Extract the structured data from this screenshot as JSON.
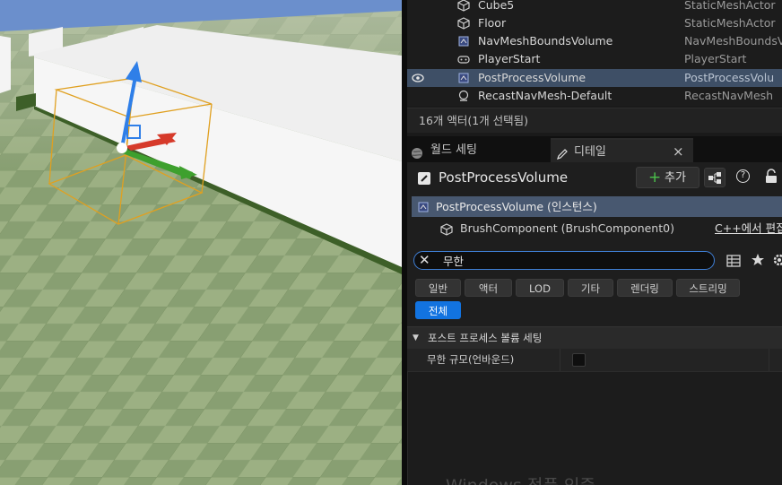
{
  "outliner": {
    "rows": [
      {
        "name": "Cube5",
        "type": "StaticMeshActor",
        "icon": "static-mesh-icon"
      },
      {
        "name": "Floor",
        "type": "StaticMeshActor",
        "icon": "static-mesh-icon"
      },
      {
        "name": "NavMeshBoundsVolume",
        "type": "NavMeshBoundsV",
        "icon": "volume-icon"
      },
      {
        "name": "PlayerStart",
        "type": "PlayerStart",
        "icon": "player-start-icon"
      },
      {
        "name": "PostProcessVolume",
        "type": "PostProcessVolu",
        "icon": "volume-icon"
      },
      {
        "name": "RecastNavMesh-Default",
        "type": "RecastNavMesh",
        "icon": "navmesh-icon"
      }
    ],
    "selected_index": 4,
    "count_text": "16개 액터(1개 선택됨)"
  },
  "tabs": {
    "world_settings": "월드 세팅",
    "details": "디테일",
    "close": "×"
  },
  "details": {
    "actor_title": "PostProcessVolume",
    "add_label": "추가",
    "add_plus": "+",
    "help_glyph": "?",
    "instance_label": "PostProcessVolume (인스턴스)",
    "component_label": "BrushComponent (BrushComponent0)",
    "edit_in_cpp": "C++에서 편집",
    "search_value": "무한",
    "clear_glyph": "✕",
    "filters": [
      "일반",
      "액터",
      "LOD",
      "기타",
      "렌더링",
      "스트리밍",
      "전체"
    ],
    "active_filter": "전체",
    "category": "포스트 프로세스 볼륨 세팅",
    "property_label": "무한 규모(언바운드)",
    "property_checked": false,
    "watermark": "Windows 정품 인증"
  },
  "colors": {
    "selection": "#3e4f66",
    "accent": "#1273e0",
    "search_border": "#3f7fd6",
    "add_green": "#4bc24b"
  }
}
